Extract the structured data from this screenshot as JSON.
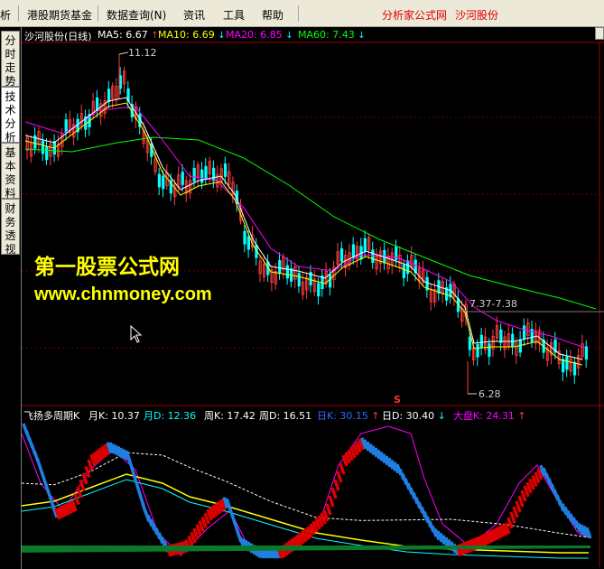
{
  "menubar": {
    "items": [
      "析",
      "港股期货基金",
      "数据查询(N)",
      "资讯",
      "工具",
      "帮助"
    ],
    "right_links": [
      "分析家公式网",
      "沙河股份"
    ]
  },
  "sidebar": {
    "tabs": [
      "分时走势",
      "技术分析",
      "基本资料",
      "财务透视"
    ],
    "active": "技术分析"
  },
  "main_chart": {
    "title": "沙河股份(日线)",
    "ma": [
      {
        "label": "MA5: 6.67",
        "arrow": "↑",
        "color": "#FFFFFF"
      },
      {
        "label": "MA10: 6.69",
        "arrow": "↓",
        "color": "#FFFF00"
      },
      {
        "label": "MA20: 6.85",
        "arrow": "↓",
        "color": "#FF00FF"
      },
      {
        "label": "MA60: 7.43",
        "arrow": "↓",
        "color": "#00FF00"
      }
    ],
    "high_label": "11.12",
    "mid_label": "7.37-7.38",
    "low_label": "6.28",
    "marker": "S"
  },
  "watermark": {
    "line1": "第一股票公式网",
    "line2": "www.chnmoney.com"
  },
  "indicator": {
    "title": "飞扬多周期K",
    "items": [
      {
        "label": "月K: 10.37",
        "color": "#FFFFFF"
      },
      {
        "label": "月D: 12.36",
        "color": "#00FFFF"
      },
      {
        "label": "周K: 17.42",
        "color": "#FFFFFF"
      },
      {
        "label": "周D: 16.51",
        "color": "#FFFFFF"
      },
      {
        "label": "日K: 30.15",
        "arrow": "↑",
        "color": "#2F6BFF"
      },
      {
        "label": "日D: 30.40",
        "arrow": "↓",
        "color": "#FFFFFF"
      },
      {
        "label": "大盘K: 24.31",
        "arrow": "↑",
        "color": "#FF00FF"
      }
    ]
  },
  "colors": {
    "up_candle": "#FF3B3B",
    "down_candle": "#00FFFF",
    "ma5": "#FFFFFF",
    "ma10": "#FFFF00",
    "ma20": "#FF00FF",
    "ma60": "#00FF00",
    "rib_red": "#E00000",
    "rib_blue": "#1E7FE0",
    "green_band": "#0A7A2A",
    "axis_red": "#A00000"
  }
}
